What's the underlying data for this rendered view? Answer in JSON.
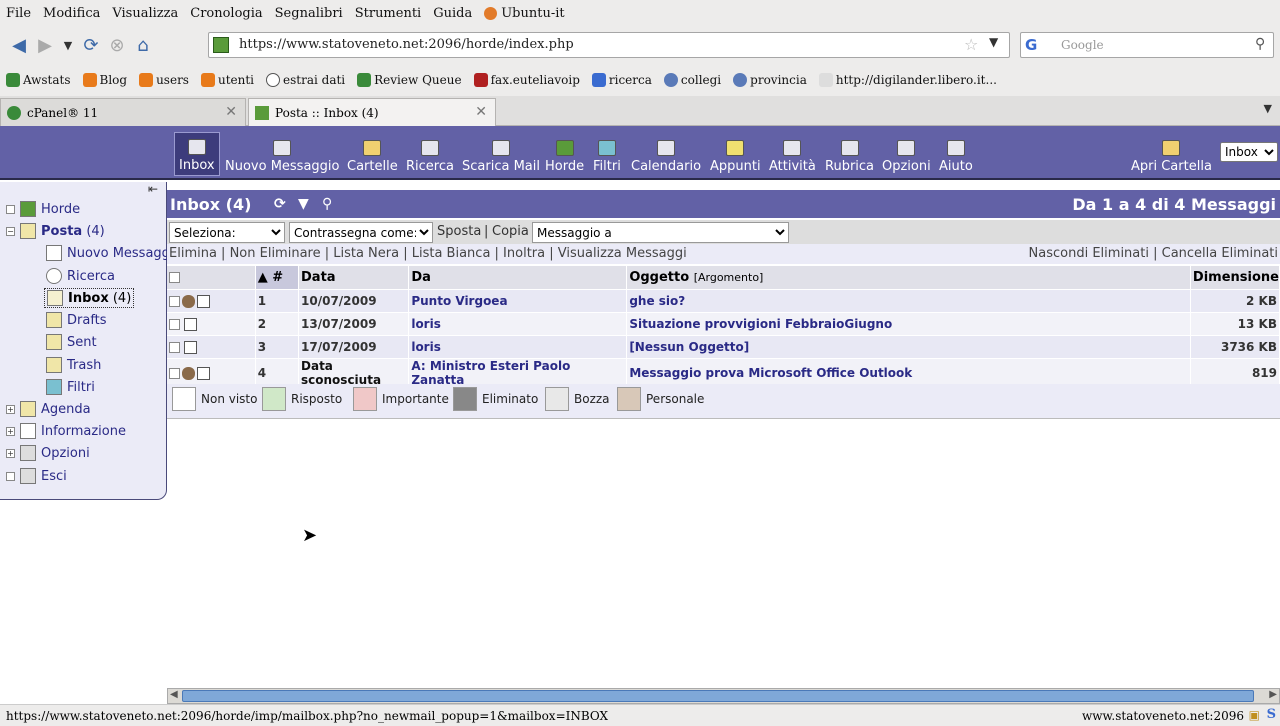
{
  "browser": {
    "menu": [
      "File",
      "Modifica",
      "Visualizza",
      "Cronologia",
      "Segnalibri",
      "Strumenti",
      "Guida",
      "Ubuntu-it"
    ],
    "url": "https://www.statoveneto.net:2096/horde/index.php",
    "search_placeholder": "Google",
    "bookmarks": [
      "Awstats",
      "Blog",
      "users",
      "utenti",
      "estrai dati",
      "Review Queue",
      "fax.euteliavoip",
      "ricerca",
      "collegi",
      "provincia",
      "http://digilander.libero.it..."
    ],
    "tabs": [
      {
        "label": "cPanel® 11"
      },
      {
        "label": "Posta :: Inbox (4)"
      }
    ],
    "status_url": "https://www.statoveneto.net:2096/horde/imp/mailbox.php?no_newmail_popup=1&mailbox=INBOX",
    "status_host": "www.statoveneto.net:2096"
  },
  "horde_menu": {
    "items": [
      "Inbox",
      "Nuovo Messaggio",
      "Cartelle",
      "Ricerca",
      "Scarica Mail",
      "Horde",
      "Filtri",
      "Calendario",
      "Appunti",
      "Attività",
      "Rubrica",
      "Opzioni",
      "Aiuto"
    ],
    "open_folder": "Apri Cartella",
    "folder_select": "Inbox"
  },
  "sidebar": {
    "horde": "Horde",
    "posta": "Posta",
    "posta_count": "(4)",
    "nuovo": "Nuovo Messaggio",
    "ricerca": "Ricerca",
    "inbox": "Inbox",
    "inbox_count": "(4)",
    "drafts": "Drafts",
    "sent": "Sent",
    "trash": "Trash",
    "filtri": "Filtri",
    "agenda": "Agenda",
    "informazione": "Informazione",
    "opzioni": "Opzioni",
    "esci": "Esci"
  },
  "mailbox": {
    "title": "Inbox (4)",
    "range": "Da 1 a 4 di 4 Messaggi",
    "seleziona": "Seleziona:",
    "contrassegna": "Contrassegna come:",
    "sposta": "Sposta",
    "copia": "Copia",
    "messaggio_a": "Messaggio a",
    "actions_left": "Elimina | Non Eliminare | Lista Nera | Lista Bianca | Inoltra | Visualizza Messaggi",
    "actions_right": "Nascondi Eliminati | Cancella Eliminati",
    "columns": {
      "num": "▲ #",
      "date": "Data",
      "from": "Da",
      "subject": "Oggetto",
      "thread": "[Argomento]",
      "size": "Dimensione"
    },
    "rows": [
      {
        "num": "1",
        "date": "10/07/2009",
        "from": "Punto Virgoea",
        "subject": "ghe sio?",
        "size": "2 KB"
      },
      {
        "num": "2",
        "date": "13/07/2009",
        "from": "loris",
        "subject": "Situazione provvigioni FebbraioGiugno",
        "size": "13 KB"
      },
      {
        "num": "3",
        "date": "17/07/2009",
        "from": "loris",
        "subject": "[Nessun Oggetto]",
        "size": "3736 KB"
      },
      {
        "num": "4",
        "date": "Data sconosciuta",
        "from": "A: Ministro Esteri Paolo Zanatta",
        "subject": "Messaggio prova Microsoft Office Outlook",
        "size": "819"
      }
    ],
    "legend": [
      "Non visto",
      "Risposto",
      "Importante",
      "Eliminato",
      "Bozza",
      "Personale"
    ]
  }
}
